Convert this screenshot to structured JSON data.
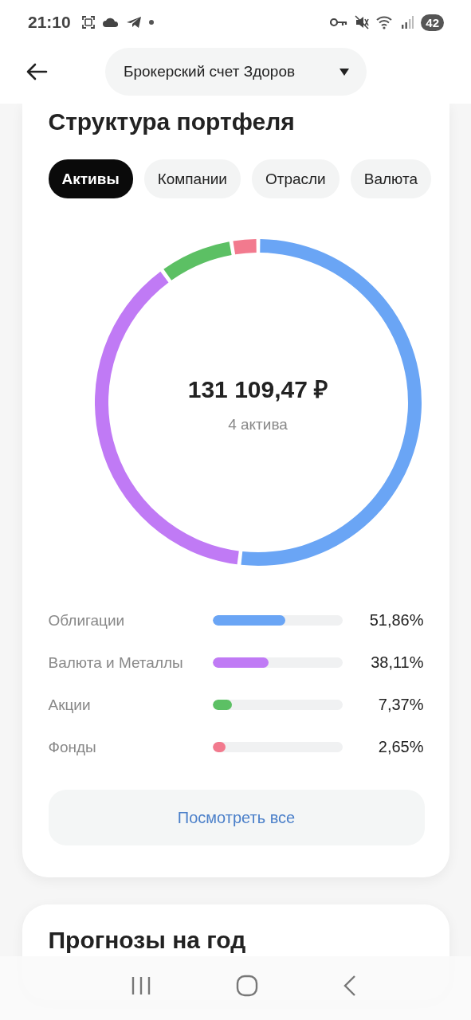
{
  "status_bar": {
    "time": "21:10",
    "battery": "42"
  },
  "header": {
    "account": "Брокерский счет Здоров"
  },
  "portfolio": {
    "title": "Структура портфеля",
    "tabs": [
      {
        "label": "Активы",
        "selected": true
      },
      {
        "label": "Компании",
        "selected": false
      },
      {
        "label": "Отрасли",
        "selected": false
      },
      {
        "label": "Валюта",
        "selected": false
      }
    ],
    "total": "131 109,47 ₽",
    "count": "4 актива",
    "chart_data": {
      "type": "donut",
      "categories": [
        "Облигации",
        "Валюта и Металлы",
        "Акции",
        "Фонды"
      ],
      "values": [
        51.86,
        38.11,
        7.37,
        2.65
      ]
    },
    "items": [
      {
        "color": "#6aa5f5",
        "level": 0.56,
        "percent": "51,86%"
      },
      {
        "color": "#c07af5",
        "level": 0.43,
        "percent": "38,11%"
      },
      {
        "color": "#5cc064",
        "level": 0.15,
        "percent": "7,37%"
      },
      {
        "color": "#f27a8e",
        "level": 0.1,
        "percent": "2,65%"
      }
    ],
    "view_all": "Посмотреть все"
  },
  "forecast": {
    "title": "Прогнозы на год"
  }
}
